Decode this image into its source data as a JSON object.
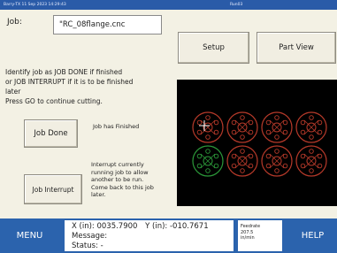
{
  "title_bar": {
    "left_text": "Barry-TX   11 Sep 2023 14:29:43",
    "right_text": "Run03"
  },
  "job": {
    "label": "Job:",
    "file": "\"RC_08flange.cnc"
  },
  "toolbar": {
    "setup_label": "Setup",
    "part_view_label": "Part View"
  },
  "instructions": {
    "line1": "Identify job as JOB DONE if finished",
    "line2": "or JOB INTERRUPT if it is to be finished",
    "line3": "later",
    "line4": "Press GO to continue cutting."
  },
  "job_done": {
    "button_label": "Job Done",
    "status_text": "Job has Finished"
  },
  "job_interrupt": {
    "button_label": "Job Interrupt",
    "description_lines": [
      "Interrupt currently",
      "running job to allow",
      "another to be run.",
      "Come back to this job",
      "later."
    ]
  },
  "bottom_bar": {
    "menu_label": "MENU",
    "help_label": "HELP",
    "x_readout": "X (in): 0035.7900",
    "y_readout": "Y (in): -010.7671",
    "message_label": "Message:",
    "status_label": "Status: -",
    "feedrate_label": "Feedrate",
    "feedrate_value": "207.5",
    "feedrate_unit": "in/min"
  },
  "colors": {
    "title_bar": "#2a5ba8",
    "bottom_bar": "#2b63ad",
    "background": "#f2f0e2",
    "preview_background": "#000000",
    "part_outline_cut": "#b83a2a",
    "part_outline_current": "#2c9a3a"
  },
  "preview_parts": [
    {
      "state": "cut"
    },
    {
      "state": "cut"
    },
    {
      "state": "cut"
    },
    {
      "state": "cut"
    },
    {
      "state": "current"
    },
    {
      "state": "cut"
    },
    {
      "state": "cut"
    },
    {
      "state": "cut"
    }
  ]
}
